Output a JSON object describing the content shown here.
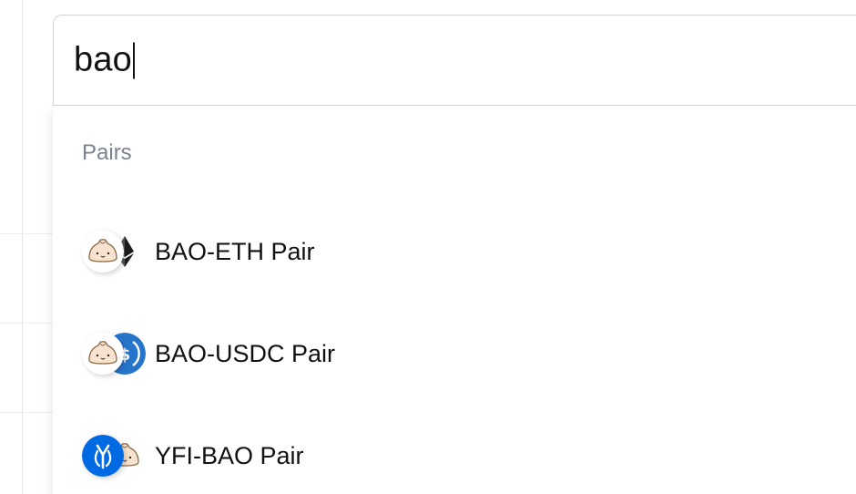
{
  "search": {
    "value": "bao"
  },
  "dropdown": {
    "section_title": "Pairs",
    "items": [
      {
        "label": "BAO-ETH Pair",
        "icons": [
          "bao-token-icon",
          "eth-token-icon"
        ]
      },
      {
        "label": "BAO-USDC Pair",
        "icons": [
          "bao-token-icon",
          "usdc-token-icon"
        ]
      },
      {
        "label": "YFI-BAO Pair",
        "icons": [
          "yfi-token-icon",
          "bao-token-icon"
        ]
      }
    ]
  },
  "colors": {
    "usdc": "#2775ca",
    "yfi": "#006ae3",
    "eth": "#1d1d1f",
    "section_header": "#7a8290",
    "border": "#cfd3d9"
  }
}
